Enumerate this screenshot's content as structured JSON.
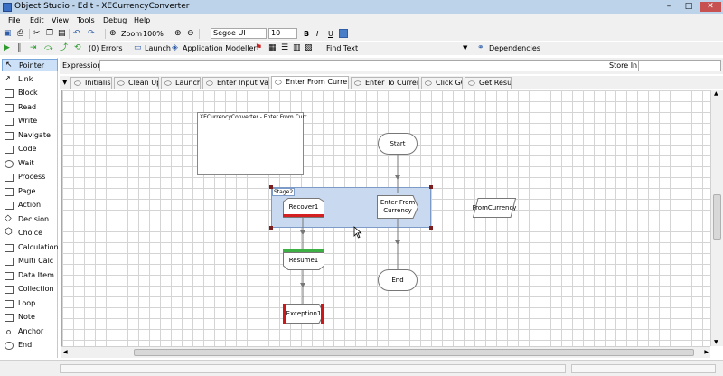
{
  "window": {
    "title": "Object Studio - Edit - XECurrencyConverter",
    "minimize": "–",
    "maximize": "□",
    "close": "✕"
  },
  "menu": [
    "File",
    "Edit",
    "View",
    "Tools",
    "Debug",
    "Help"
  ],
  "toolbar1": {
    "zoom_label": "Zoom",
    "zoom_value": "100%",
    "font_value": "Segoe UI",
    "size_value": "10",
    "bold": "B",
    "italic": "I",
    "underline": "U"
  },
  "toolbar2": {
    "errors_label": "(0) Errors",
    "launch_label": "Launch",
    "app_modeller_label": "Application Modeller",
    "find_text_label": "Find Text",
    "dependencies_label": "Dependencies"
  },
  "expression": {
    "label": "Expression:",
    "value": "",
    "store_in_label": "Store In:",
    "store_in_value": ""
  },
  "tools": [
    "Pointer",
    "Link",
    "Block",
    "Read",
    "Write",
    "Navigate",
    "Code",
    "Wait",
    "Process",
    "Page",
    "Action",
    "Decision",
    "Choice",
    "Calculation",
    "Multi Calc",
    "Data Item",
    "Collection",
    "Loop",
    "Note",
    "Anchor",
    "End"
  ],
  "tabs": [
    "Initialise",
    "Clean Up",
    "Launch",
    "Enter Input Value",
    "Enter From Currency",
    "Enter To Currency",
    "Click GO",
    "Get Result"
  ],
  "active_tab": "Enter From Currency",
  "diagram": {
    "info_box": "XECurrencyConverter - Enter From Curr",
    "block_label": "Stage2",
    "start": "Start",
    "end": "End",
    "recover": "Recover1",
    "resume": "Resume1",
    "exception": "Exception1",
    "action": "Enter From Currency",
    "data_item": "FromCurrency"
  },
  "colors": {
    "accent": "#4a7ec7",
    "block_fill": "#c9d9ef",
    "recover_bar": "#d42020",
    "resume_bar": "#3cb043",
    "exception_bar": "#cc1818"
  }
}
